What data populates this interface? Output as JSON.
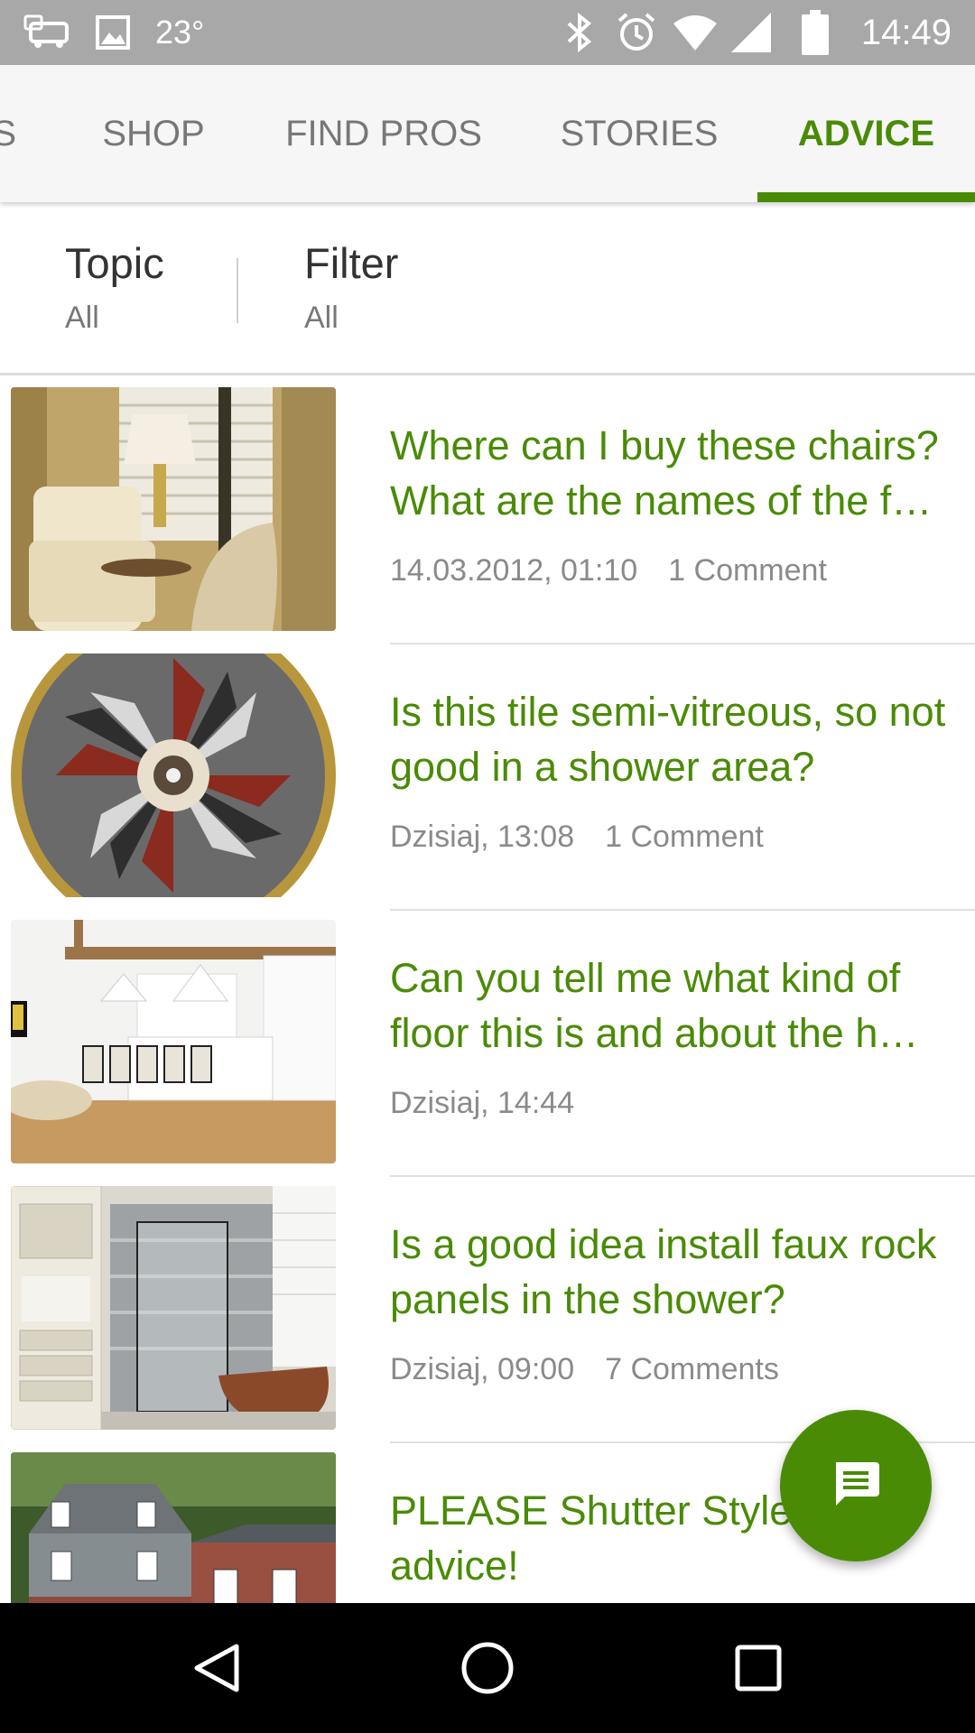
{
  "status_bar": {
    "temperature": "23°",
    "time": "14:49",
    "battery_level": "100",
    "icons": [
      "car-icon",
      "image-icon",
      "bluetooth-icon",
      "alarm-icon",
      "wifi-icon",
      "signal-icon",
      "battery-icon"
    ]
  },
  "tabs": [
    {
      "label": "S"
    },
    {
      "label": "SHOP"
    },
    {
      "label": "FIND PROS"
    },
    {
      "label": "STORIES"
    },
    {
      "label": "ADVICE"
    }
  ],
  "active_tab": "ADVICE",
  "filters": {
    "topic_label": "Topic",
    "topic_value": "All",
    "filter_label": "Filter",
    "filter_value": "All"
  },
  "questions": [
    {
      "title": "Where can I buy these chairs? What are the names of the f…",
      "date": "14.03.2012, 01:10",
      "comments": "1 Comment"
    },
    {
      "title": "Is this tile semi-vitreous, so not good in a shower area?",
      "date": "Dzisiaj, 13:08",
      "comments": "1 Comment"
    },
    {
      "title": "Can you tell me what kind of floor this is and about the h…",
      "date": "Dzisiaj, 14:44",
      "comments": ""
    },
    {
      "title": "Is a good idea install faux rock panels in the shower?",
      "date": "Dzisiaj, 09:00",
      "comments": "7 Comments"
    },
    {
      "title": "PLEASE Shutter Style Color advice!",
      "date": "",
      "comments": ""
    }
  ],
  "fab": {
    "icon": "message-icon"
  },
  "nav": {
    "icons": [
      "back-icon",
      "home-icon",
      "recents-icon"
    ]
  },
  "colors": {
    "accent": "#4a8b06",
    "status_bar": "#a8a8a8",
    "nav_bar": "#000000"
  }
}
